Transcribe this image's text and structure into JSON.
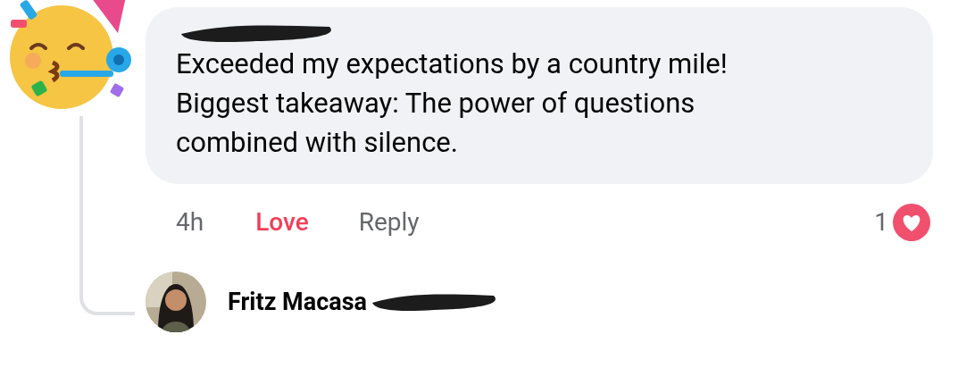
{
  "comment": {
    "text": "Exceeded my expectations by a country mile! Biggest takeaway: The power of questions combined with silence.",
    "time": "4h",
    "actions": [
      {
        "label": "Love",
        "reacted": true
      },
      {
        "label": "Reply",
        "reacted": false
      }
    ],
    "reaction_count": "1"
  },
  "reply": {
    "author": "Fritz Macasa"
  }
}
